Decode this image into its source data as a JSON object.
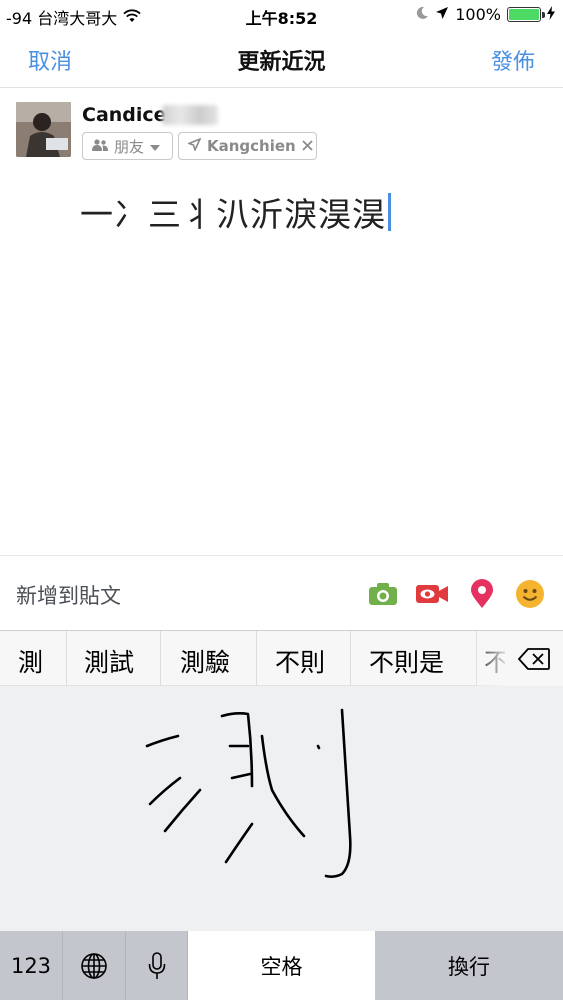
{
  "status_bar": {
    "carrier": "-94 台湾大哥大",
    "time": "上午8:52",
    "battery": "100%",
    "battery_level": 1.0
  },
  "nav": {
    "cancel": "取消",
    "title": "更新近況",
    "post": "發佈"
  },
  "composer": {
    "user_name": "Candice",
    "audience": "朋友",
    "location": "Kangchien",
    "post_text": "一冫三丬汃沂淚淏淏"
  },
  "add_to_post": {
    "label": "新增到貼文",
    "icons": [
      "camera-icon",
      "live-video-icon",
      "check-in-icon",
      "feeling-icon"
    ]
  },
  "keyboard": {
    "candidates": [
      "測",
      "測試",
      "測驗",
      "不則",
      "不則是",
      "不"
    ],
    "keys": {
      "numbers": "123",
      "space": "空格",
      "return": "換行"
    }
  },
  "colors": {
    "accent": "#4a90e2",
    "camera": "#72b04b",
    "live": "#e0393e",
    "checkin": "#e5315f",
    "feeling": "#f5b330"
  }
}
